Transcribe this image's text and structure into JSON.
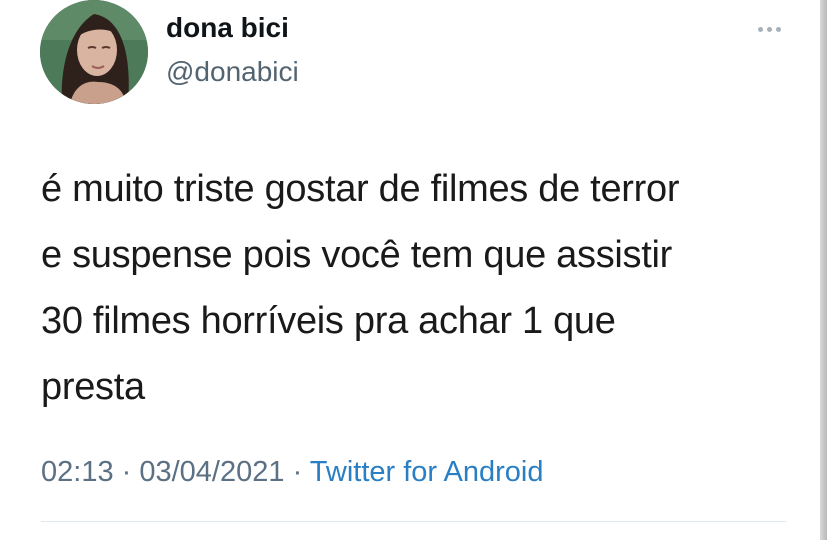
{
  "tweet": {
    "author": {
      "display_name": "dona bici",
      "handle": "@donabici",
      "avatar_icon": "user-avatar-photo"
    },
    "more_icon": "more-options-icon",
    "text_lines": [
      "é muito triste gostar de filmes de terror",
      "e suspense pois você tem que assistir",
      "30 filmes horríveis pra achar 1 que",
      "presta"
    ],
    "meta": {
      "time": "02:13",
      "separator": " · ",
      "date": "03/04/2021",
      "source": "Twitter for Android"
    }
  },
  "colors": {
    "text": "#1a1a1a",
    "secondary": "#5b7083",
    "link": "#2a7fc4",
    "divider": "#e1e8ed"
  }
}
